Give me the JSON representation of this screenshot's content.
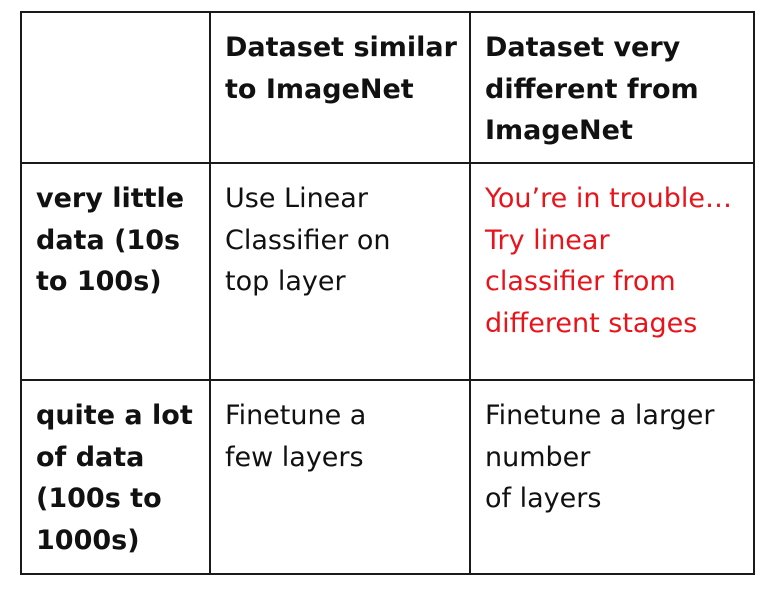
{
  "table": {
    "header": {
      "corner": "",
      "col1_lines": [
        "Dataset similar",
        "to ImageNet"
      ],
      "col2_lines": [
        "Dataset very",
        "different from",
        "ImageNet"
      ]
    },
    "rows": [
      {
        "label_lines": [
          "very little",
          "data (10s",
          "to 100s)"
        ],
        "similar_lines": [
          "Use Linear",
          "Classifier on",
          "top layer"
        ],
        "different_lines": [
          "You’re in trouble…",
          "Try linear",
          "classifier from",
          "different stages"
        ]
      },
      {
        "label_lines": [
          "quite a lot",
          "of data",
          "(100s to",
          "1000s)"
        ],
        "similar_lines": [
          "Finetune a",
          "few layers"
        ],
        "different_lines": [
          "Finetune a larger",
          "number",
          "of layers"
        ]
      }
    ],
    "colors": {
      "text": "#111111",
      "warning_text": "#e8141b",
      "border": "#1a1a1a"
    }
  }
}
